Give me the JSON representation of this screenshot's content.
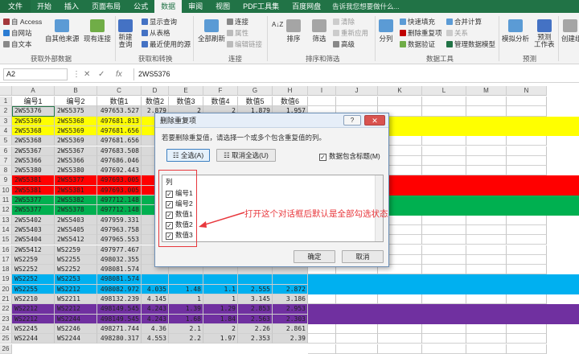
{
  "ribbon_tabs": [
    "文件",
    "开始",
    "插入",
    "页面布局",
    "公式",
    "数据",
    "审阅",
    "视图",
    "PDF工具集",
    "百度网盘"
  ],
  "tell_me": "告诉我您想要做什么...",
  "ribbon": {
    "access": "自 Access",
    "web": "自网站",
    "text": "自文本",
    "other_sources": "自其他来源",
    "existing_conn": "现有连接",
    "new_query": "新建\n查询",
    "show_query": "显示查询",
    "from_table": "从表格",
    "recent_sources": "最近使用的源",
    "refresh_all": "全部刷新",
    "connections": "连接",
    "properties": "属性",
    "edit_links": "编辑链接",
    "sort_az": "A↓Z",
    "sort": "排序",
    "filter": "筛选",
    "clear": "清除",
    "reapply": "重新应用",
    "advanced": "高级",
    "split": "分列",
    "flash_fill": "快速填充",
    "remove_dup": "删除重复项",
    "validation": "数据验证",
    "consolidate": "合并计算",
    "relations": "关系",
    "data_model": "管理数据模型",
    "what_if": "模拟分析",
    "forecast": "预测\n工作表",
    "group": "创建组",
    "grp_external": "获取外部数据",
    "grp_transform": "获取和转换",
    "grp_conn": "连接",
    "grp_sort": "排序和筛选",
    "grp_tools": "数据工具",
    "grp_forecast": "预测"
  },
  "name_box": "A2",
  "formula_bar": "2WS5376",
  "fx": "fx",
  "columns": [
    "A",
    "B",
    "C",
    "D",
    "E",
    "F",
    "G",
    "H",
    "I",
    "J",
    "K",
    "L",
    "M",
    "N"
  ],
  "headers": [
    "编号1",
    "编号2",
    "数值1",
    "数值2",
    "数值3",
    "数值4",
    "数值5",
    "数值6"
  ],
  "rows": [
    [
      "2WS5376",
      "2WS5375",
      "497653.527",
      "2.879",
      "2",
      "2",
      "1.879",
      "1.957"
    ],
    [
      "2WS5369",
      "2WS5368",
      "497681.813",
      "",
      "",
      "",
      "",
      ""
    ],
    [
      "2WS5368",
      "2WS5369",
      "497681.656",
      "",
      "",
      "",
      "",
      ""
    ],
    [
      "2WS5368",
      "2WS5369",
      "497681.656",
      "",
      "",
      "",
      "",
      ""
    ],
    [
      "2WS5367",
      "2WS5367",
      "497683.508",
      "",
      "",
      "",
      "",
      ""
    ],
    [
      "2WS5366",
      "2WS5366",
      "497686.046",
      "",
      "",
      "",
      "",
      ""
    ],
    [
      "2WS5380",
      "2WS5380",
      "497692.443",
      "",
      "",
      "",
      "",
      ""
    ],
    [
      "2WS5381",
      "2WS5377",
      "497693.005",
      "",
      "",
      "",
      "",
      ""
    ],
    [
      "2WS5381",
      "2WS5381",
      "497693.005",
      "",
      "",
      "",
      "",
      ""
    ],
    [
      "2WS5377",
      "2WS5382",
      "497712.148",
      "",
      "",
      "",
      "",
      ""
    ],
    [
      "2WS5377",
      "2WS5378",
      "497712.148",
      "",
      "",
      "",
      "",
      ""
    ],
    [
      "2WS5402",
      "2WS5403",
      "497959.331",
      "",
      "",
      "",
      "",
      ""
    ],
    [
      "2WS5403",
      "2WS5405",
      "497963.758",
      "",
      "",
      "",
      "",
      ""
    ],
    [
      "2WS5404",
      "2WS5412",
      "497965.553",
      "",
      "",
      "",
      "",
      ""
    ],
    [
      "2WS5412",
      "WS2259",
      "497977.467",
      "",
      "",
      "",
      "",
      ""
    ],
    [
      "WS2259",
      "WS2255",
      "498032.355",
      "",
      "",
      "",
      "",
      ""
    ],
    [
      "WS2252",
      "WS2252",
      "498081.574",
      "",
      "",
      "",
      "",
      ""
    ],
    [
      "WS2252",
      "WS2253",
      "498081.574",
      "",
      "",
      "",
      "",
      ""
    ],
    [
      "WS2255",
      "WS2212",
      "498082.972",
      "4.035",
      "1.48",
      "1.1",
      "2.555",
      "2.872"
    ],
    [
      "WS2210",
      "WS2211",
      "498132.239",
      "4.145",
      "1",
      "1",
      "3.145",
      "3.186"
    ],
    [
      "WS2212",
      "WS2212",
      "498149.545",
      "4.243",
      "1.39",
      "1.29",
      "2.853",
      "2.953"
    ],
    [
      "WS2212",
      "WS2244",
      "498149.545",
      "4.243",
      "1.68",
      "1.84",
      "2.563",
      "2.303"
    ],
    [
      "WS2245",
      "WS2246",
      "498271.744",
      "4.36",
      "2.1",
      "2",
      "2.26",
      "2.861"
    ],
    [
      "WS2244",
      "WS2244",
      "498280.317",
      "4.553",
      "2.2",
      "1.97",
      "2.353",
      "2.39"
    ]
  ],
  "row_numbers": [
    "1",
    "2",
    "3",
    "4",
    "5",
    "6",
    "7",
    "8",
    "9",
    "10",
    "11",
    "12",
    "13",
    "14",
    "15",
    "16",
    "17",
    "18",
    "19",
    "20",
    "21",
    "22",
    "23",
    "24",
    "25",
    "26"
  ],
  "dialog": {
    "title": "删除重复项",
    "help": "?",
    "close": "✕",
    "description": "若要删除重复值，请选择一个或多个包含重复值的列。",
    "select_all": "全选(A)",
    "unselect_all": "取消全选(U)",
    "has_headers": "数据包含标题(M)",
    "list_header": "列",
    "items": [
      "编号1",
      "编号2",
      "数值1",
      "数值2",
      "数值3"
    ],
    "ok": "确定",
    "cancel": "取消"
  },
  "annotation": "打开这个对话框后默认是全部勾选状态",
  "band_colors": {
    "yellow": "#ffff00",
    "red": "#ff0000",
    "green": "#00b050",
    "blue": "#00b0f0",
    "purple": "#7030a0",
    "selection": "#d9d9d9"
  }
}
